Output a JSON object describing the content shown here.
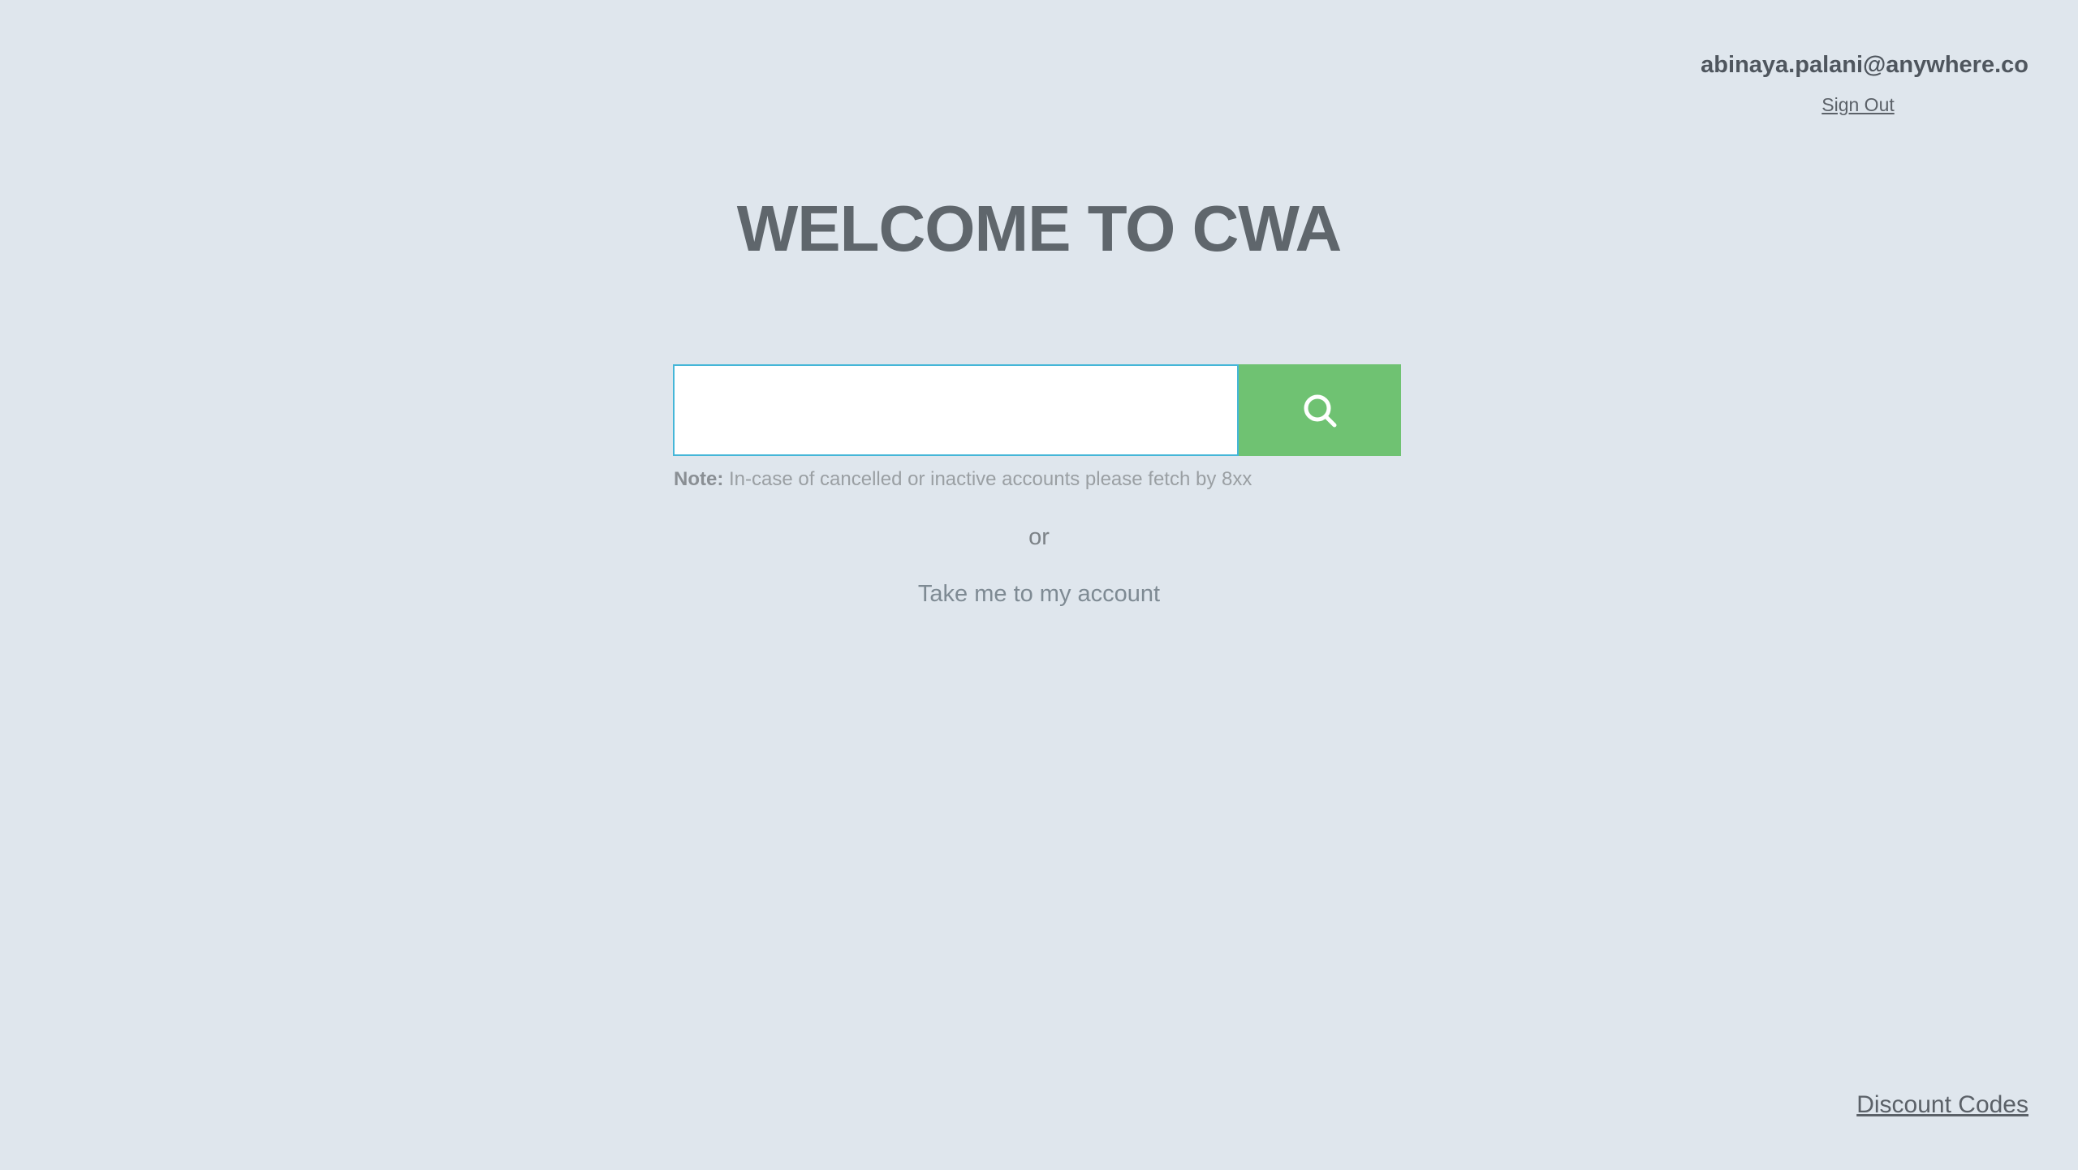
{
  "header": {
    "user_email": "abinaya.palani@anywhere.co",
    "sign_out_label": "Sign Out"
  },
  "main": {
    "title": "WELCOME TO CWA",
    "search": {
      "value": "",
      "placeholder": "",
      "button_icon": "search-icon"
    },
    "note": {
      "label": "Note:",
      "text": " In-case of cancelled or inactive accounts please fetch by 8xx"
    },
    "or_text": "or",
    "account_link_label": "Take me to my account"
  },
  "footer": {
    "discount_codes_label": "Discount Codes"
  },
  "colors": {
    "background": "#dfe6ed",
    "search_button": "#6fc272",
    "input_border": "#45b6d8"
  }
}
